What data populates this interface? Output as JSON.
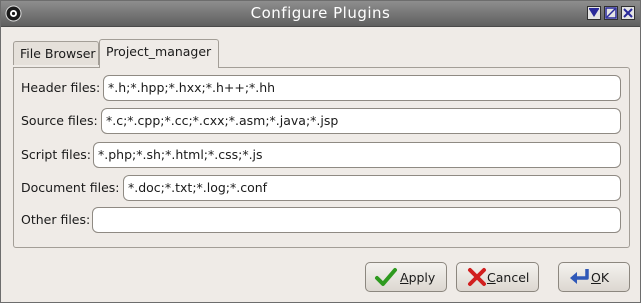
{
  "window": {
    "title": "Configure Plugins"
  },
  "tabs": [
    {
      "label": "File Browser",
      "active": false
    },
    {
      "label": "Project_manager",
      "active": true
    }
  ],
  "fields": {
    "header": {
      "label": "Header files:",
      "value": "*.h;*.hpp;*.hxx;*.h++;*.hh"
    },
    "source": {
      "label": "Source files:",
      "value": "*.c;*.cpp;*.cc;*.cxx;*.asm;*.java;*.jsp"
    },
    "script": {
      "label": "Script files:",
      "value": "*.php;*.sh;*.html;*.css;*.js"
    },
    "document": {
      "label": "Document files:",
      "value": "*.doc;*.txt;*.log;*.conf"
    },
    "other": {
      "label": "Other files:",
      "value": ""
    }
  },
  "buttons": {
    "apply": {
      "mnemonic": "A",
      "rest": "pply"
    },
    "cancel": {
      "mnemonic": "C",
      "rest": "ancel"
    },
    "ok": {
      "mnemonic": "O",
      "rest": "K"
    }
  },
  "icons": {
    "window_menu": "window-menu-icon",
    "shade": "shade-icon",
    "maximize": "maximize-icon",
    "close": "close-icon",
    "apply": "checkmark-icon",
    "cancel": "cancel-x-icon",
    "ok": "enter-arrow-icon"
  },
  "colors": {
    "titlebar": "#6f6f6f",
    "background": "#efebe7",
    "apply_icon": "#2e9a1f",
    "cancel_icon": "#d21f1f",
    "ok_icon": "#2f58b8"
  }
}
